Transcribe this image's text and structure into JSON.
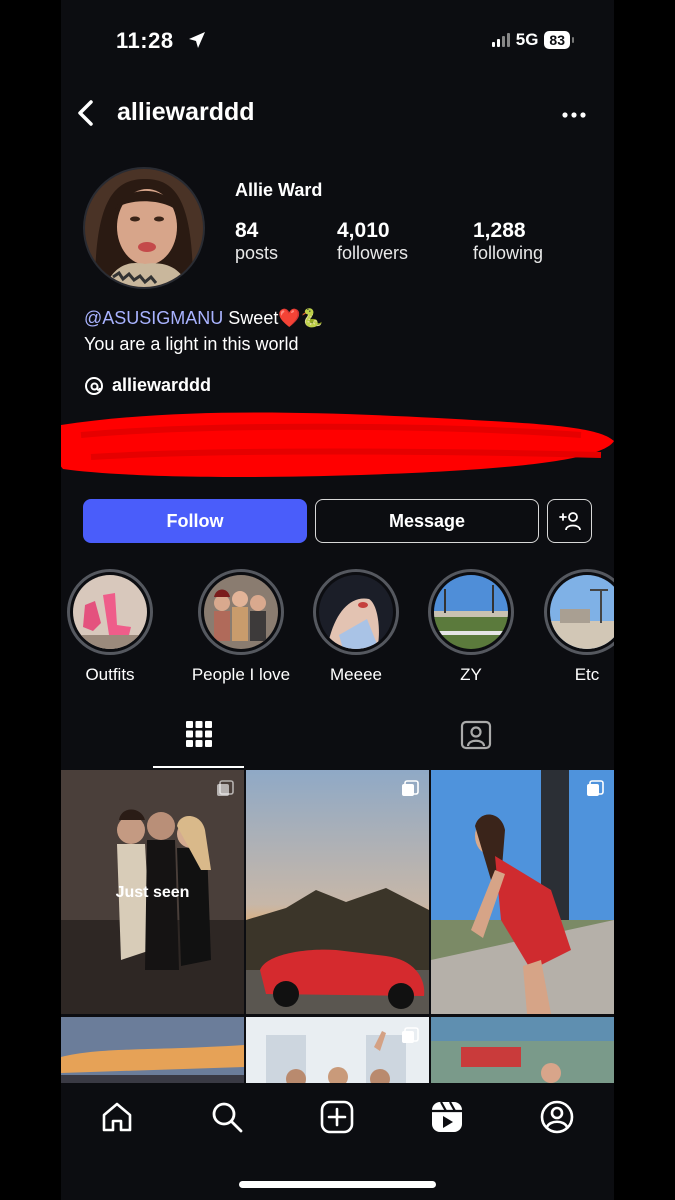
{
  "status_bar": {
    "time": "11:28",
    "network": "5G",
    "battery": "83"
  },
  "header": {
    "username": "alliewarddd"
  },
  "profile": {
    "display_name": "Allie Ward",
    "stats": [
      {
        "value": "84",
        "label": "posts"
      },
      {
        "value": "4,010",
        "label": "followers"
      },
      {
        "value": "1,288",
        "label": "following"
      }
    ],
    "bio_mention": "@ASUSIGMANU",
    "bio_line1_rest": " Sweet❤️🐍",
    "bio_line2": "You are a light in this world",
    "threads_handle": "alliewarddd"
  },
  "actions": {
    "follow_label": "Follow",
    "message_label": "Message"
  },
  "highlights": [
    {
      "label": "Outfits"
    },
    {
      "label": "People I love"
    },
    {
      "label": "Meeee"
    },
    {
      "label": "ZY"
    },
    {
      "label": "Etc"
    }
  ],
  "grid": {
    "first_post_overlay": "Just seen"
  },
  "colors": {
    "background": "#0c0d11",
    "follow_button": "#4a5dfa",
    "mention": "#a9b3ff",
    "redaction": "#ff0000"
  }
}
